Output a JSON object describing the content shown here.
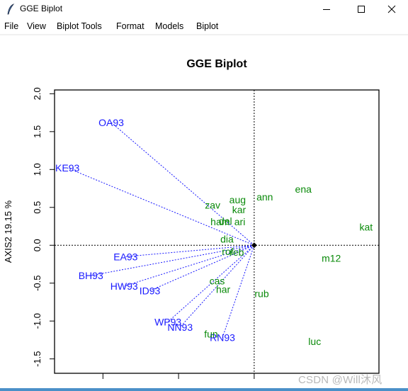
{
  "window": {
    "title": "GGE Biplot",
    "icon": "feather-icon",
    "controls": [
      "minimize-icon",
      "maximize-icon",
      "close-icon"
    ]
  },
  "menu": {
    "items": [
      {
        "label": "File"
      },
      {
        "label": "View"
      },
      {
        "label": "Biplot Tools"
      },
      {
        "label": "Format"
      },
      {
        "label": "Models"
      },
      {
        "label": "Biplot"
      }
    ]
  },
  "watermark": "CSDN @Will沐风",
  "colors": {
    "environment": "#1a1aff",
    "genotype": "#0a8a0a",
    "axis": "#000000"
  },
  "chart_data": {
    "type": "scatter",
    "title": "GGE Biplot",
    "xlabel": "",
    "ylabel": "AXIS2 19.15 %",
    "xlim": [
      -2.64,
      1.65
    ],
    "ylim": [
      -1.69,
      2.05
    ],
    "xticks": [
      -2,
      -1,
      0
    ],
    "yticks": [
      2.0,
      1.5,
      1.0,
      0.5,
      0.0,
      -0.5,
      -1.0,
      -1.5
    ],
    "ytick_labels": [
      "2.0",
      "1.5",
      "1.0",
      "0.5",
      "0.0",
      "-0.5",
      "-1.0",
      "-1.5"
    ],
    "grid": false,
    "reference_lines": {
      "x": 0,
      "y": 0,
      "style": "dotted"
    },
    "origin_marker": true,
    "environments": [
      {
        "label": "OA93",
        "x": -1.89,
        "y": 1.62
      },
      {
        "label": "KE93",
        "x": -2.47,
        "y": 1.02
      },
      {
        "label": "EA93",
        "x": -1.7,
        "y": -0.15
      },
      {
        "label": "BH93",
        "x": -2.16,
        "y": -0.4
      },
      {
        "label": "HW93",
        "x": -1.72,
        "y": -0.54
      },
      {
        "label": "ID93",
        "x": -1.38,
        "y": -0.6
      },
      {
        "label": "WP93",
        "x": -1.14,
        "y": -1.01
      },
      {
        "label": "NN93",
        "x": -0.98,
        "y": -1.08
      },
      {
        "label": "RN93",
        "x": -0.42,
        "y": -1.22
      }
    ],
    "genotypes": [
      {
        "label": "zav",
        "x": -0.55,
        "y": 0.53
      },
      {
        "label": "aug",
        "x": -0.22,
        "y": 0.6
      },
      {
        "label": "kar",
        "x": -0.2,
        "y": 0.47
      },
      {
        "label": "ham",
        "x": -0.45,
        "y": 0.31
      },
      {
        "label": "del",
        "x": -0.38,
        "y": 0.32
      },
      {
        "label": "ari",
        "x": -0.19,
        "y": 0.31
      },
      {
        "label": "dia",
        "x": -0.36,
        "y": 0.08
      },
      {
        "label": "rof",
        "x": -0.35,
        "y": -0.08
      },
      {
        "label": "reb",
        "x": -0.23,
        "y": -0.09
      },
      {
        "label": "ann",
        "x": 0.14,
        "y": 0.64
      },
      {
        "label": "ena",
        "x": 0.65,
        "y": 0.74
      },
      {
        "label": "kat",
        "x": 1.48,
        "y": 0.24
      },
      {
        "label": "m12",
        "x": 1.02,
        "y": -0.17
      },
      {
        "label": "cas",
        "x": -0.49,
        "y": -0.47
      },
      {
        "label": "har",
        "x": -0.41,
        "y": -0.58
      },
      {
        "label": "rub",
        "x": 0.1,
        "y": -0.64
      },
      {
        "label": "fun",
        "x": -0.57,
        "y": -1.17
      },
      {
        "label": "luc",
        "x": 0.8,
        "y": -1.27
      }
    ]
  }
}
